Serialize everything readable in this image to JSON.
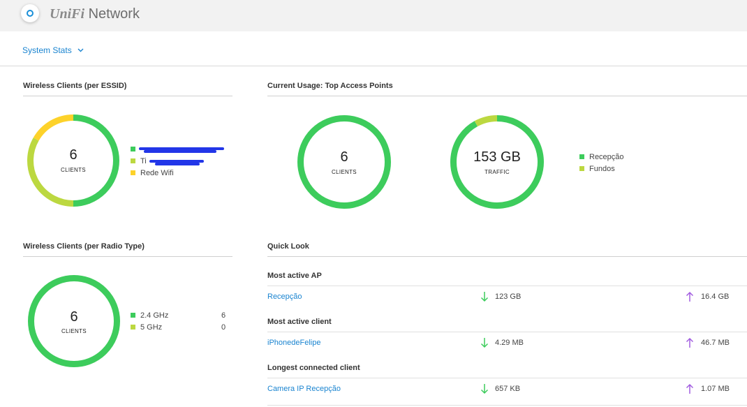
{
  "app": {
    "brand_logo": "UniFi",
    "brand_name": "Network"
  },
  "subheader": {
    "dropdown_label": "System Stats"
  },
  "colors": {
    "green": "#3dcc5c",
    "lime": "#bcd840",
    "yellow": "#fdd22a",
    "link": "#1a84d0",
    "purple": "#a25ee0"
  },
  "wireless_essid": {
    "title": "Wireless Clients (per ESSID)",
    "value": "6",
    "unit": "CLIENTS",
    "legend": [
      {
        "label": "",
        "color": "#3dcc5c",
        "redacted": true
      },
      {
        "label": "Ti",
        "color": "#bcd840",
        "redacted": true
      },
      {
        "label": "Rede Wifi",
        "color": "#fdd22a"
      }
    ],
    "segments": [
      {
        "fraction": 0.5,
        "color": "#3dcc5c"
      },
      {
        "fraction": 0.333,
        "color": "#bcd840"
      },
      {
        "fraction": 0.167,
        "color": "#fdd22a"
      }
    ]
  },
  "top_access_points": {
    "title": "Current Usage: Top Access Points",
    "clients": {
      "value": "6",
      "unit": "CLIENTS",
      "segments": [
        {
          "fraction": 1.0,
          "color": "#3dcc5c"
        }
      ]
    },
    "traffic": {
      "value": "153 GB",
      "unit": "TRAFFIC",
      "segments": [
        {
          "fraction": 0.92,
          "color": "#3dcc5c"
        },
        {
          "fraction": 0.08,
          "color": "#bcd840"
        }
      ]
    },
    "legend": [
      {
        "label": "Recepção",
        "color": "#3dcc5c"
      },
      {
        "label": "Fundos",
        "color": "#bcd840"
      }
    ]
  },
  "wireless_radio": {
    "title": "Wireless Clients (per Radio Type)",
    "value": "6",
    "unit": "CLIENTS",
    "legend": [
      {
        "label": "2.4 GHz",
        "count": "6",
        "color": "#3dcc5c"
      },
      {
        "label": "5 GHz",
        "count": "0",
        "color": "#bcd840"
      }
    ],
    "segments": [
      {
        "fraction": 1.0,
        "color": "#3dcc5c"
      }
    ]
  },
  "quick_look": {
    "title": "Quick Look",
    "groups": [
      {
        "title": "Most active AP",
        "name": "Recepção",
        "down": "123 GB",
        "up": "16.4 GB"
      },
      {
        "title": "Most active client",
        "name": "iPhonedeFelipe",
        "down": "4.29 MB",
        "up": "46.7 MB"
      },
      {
        "title": "Longest connected client",
        "name": "Camera IP Recepção",
        "down": "657 KB",
        "up": "1.07 MB"
      }
    ]
  }
}
